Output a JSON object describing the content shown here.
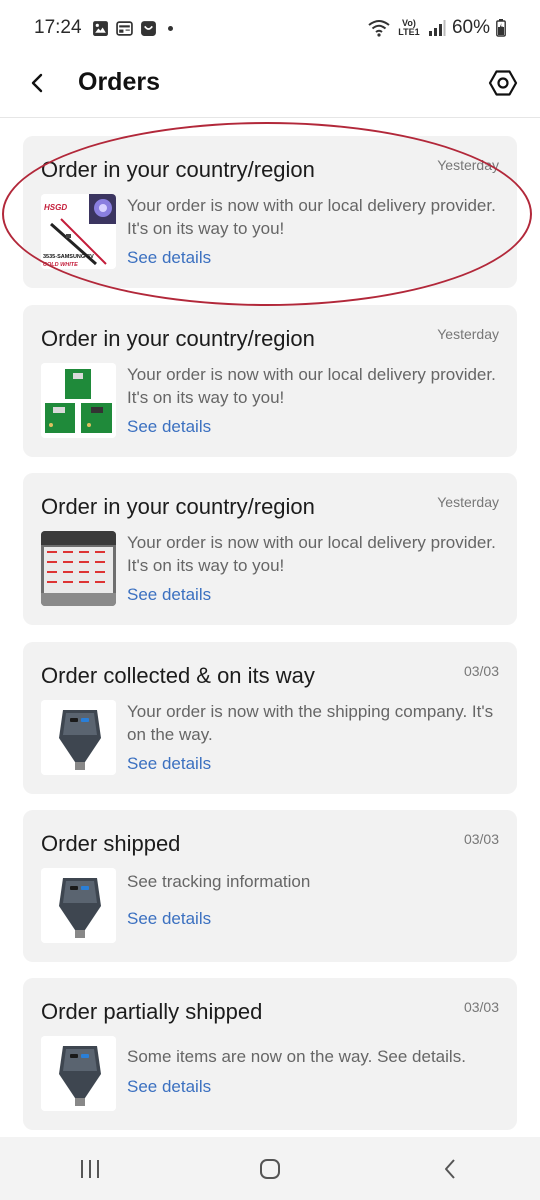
{
  "status_bar": {
    "time": "17:24",
    "network": "Vo) LTE1",
    "battery": "60%"
  },
  "header": {
    "title": "Orders",
    "back_icon": "back-arrow-icon",
    "settings_icon": "hexagon-settings-icon"
  },
  "orders": [
    {
      "title": "Order in your country/region",
      "date": "Yesterday",
      "message": "Your order is now with our local delivery provider. It's on its way to you!",
      "link": "See details",
      "thumb": "led-strip"
    },
    {
      "title": "Order in your country/region",
      "date": "Yesterday",
      "message": "Your order is now with our local delivery provider. It's on its way to you!",
      "link": "See details",
      "thumb": "green-boards"
    },
    {
      "title": "Order in your country/region",
      "date": "Yesterday",
      "message": "Your order is now with our local delivery provider. It's on its way to you!",
      "link": "See details",
      "thumb": "labels"
    },
    {
      "title": "Order collected & on its way",
      "date": "03/03",
      "message": "Your order is now with the shipping company. It's on the way.",
      "link": "See details",
      "thumb": "car-charger"
    },
    {
      "title": "Order shipped",
      "date": "03/03",
      "message": "See tracking information",
      "link": "See details",
      "thumb": "car-charger"
    },
    {
      "title": "Order partially shipped",
      "date": "03/03",
      "message": "Some items are now on the way. See details.",
      "link": "See details",
      "thumb": "car-charger"
    }
  ],
  "thumb_text": {
    "led_brand": "HSGD",
    "led_model": "3535-SAMSUNG-3V",
    "led_color": "COLD WHITE"
  },
  "colors": {
    "link": "#3b70c0",
    "card_bg": "#f2f2f2",
    "highlight": "#b2283a"
  }
}
